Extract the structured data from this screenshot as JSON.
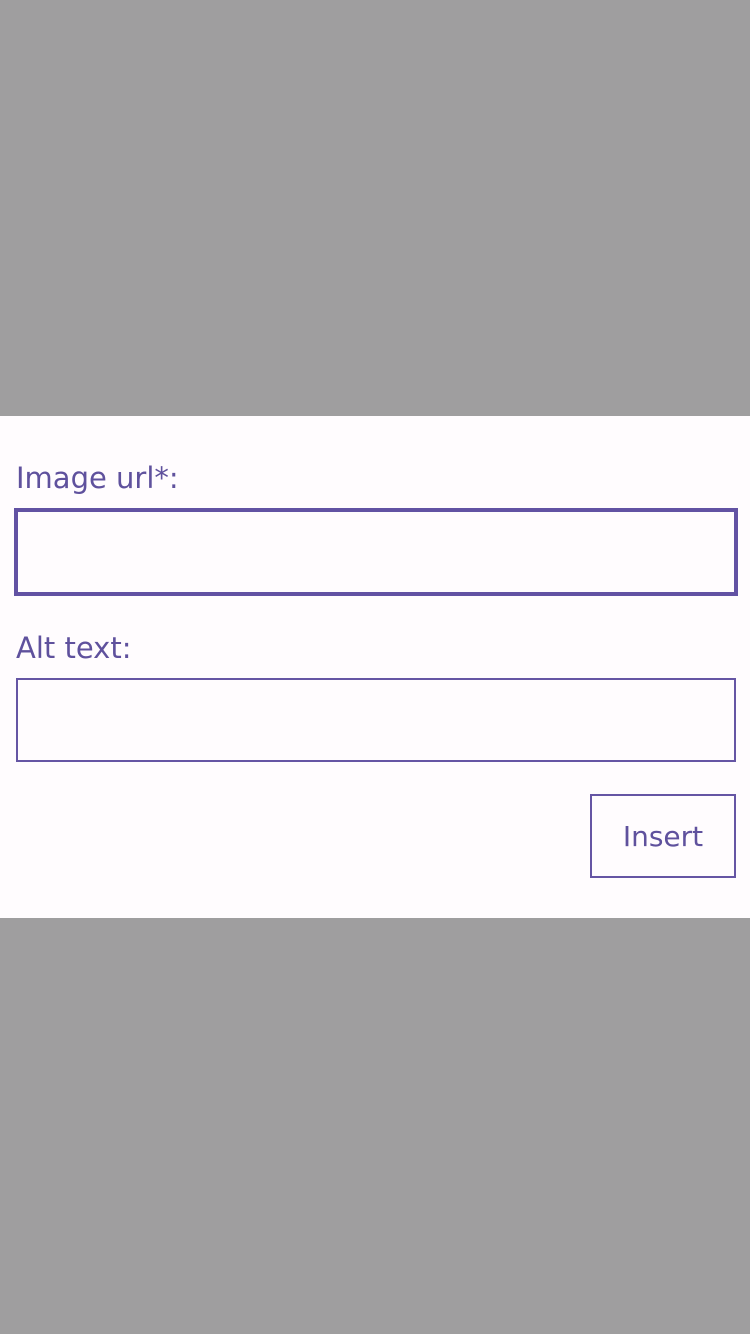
{
  "dialog": {
    "image_url": {
      "label": "Image url*:",
      "value": "",
      "placeholder": ""
    },
    "alt_text": {
      "label": "Alt text:",
      "value": "",
      "placeholder": ""
    },
    "insert_label": "Insert"
  },
  "colors": {
    "backdrop": "#9f9e9f",
    "dialog_background": "#fffcfe",
    "accent": "#6555a4",
    "label_text": "#5f519d"
  }
}
